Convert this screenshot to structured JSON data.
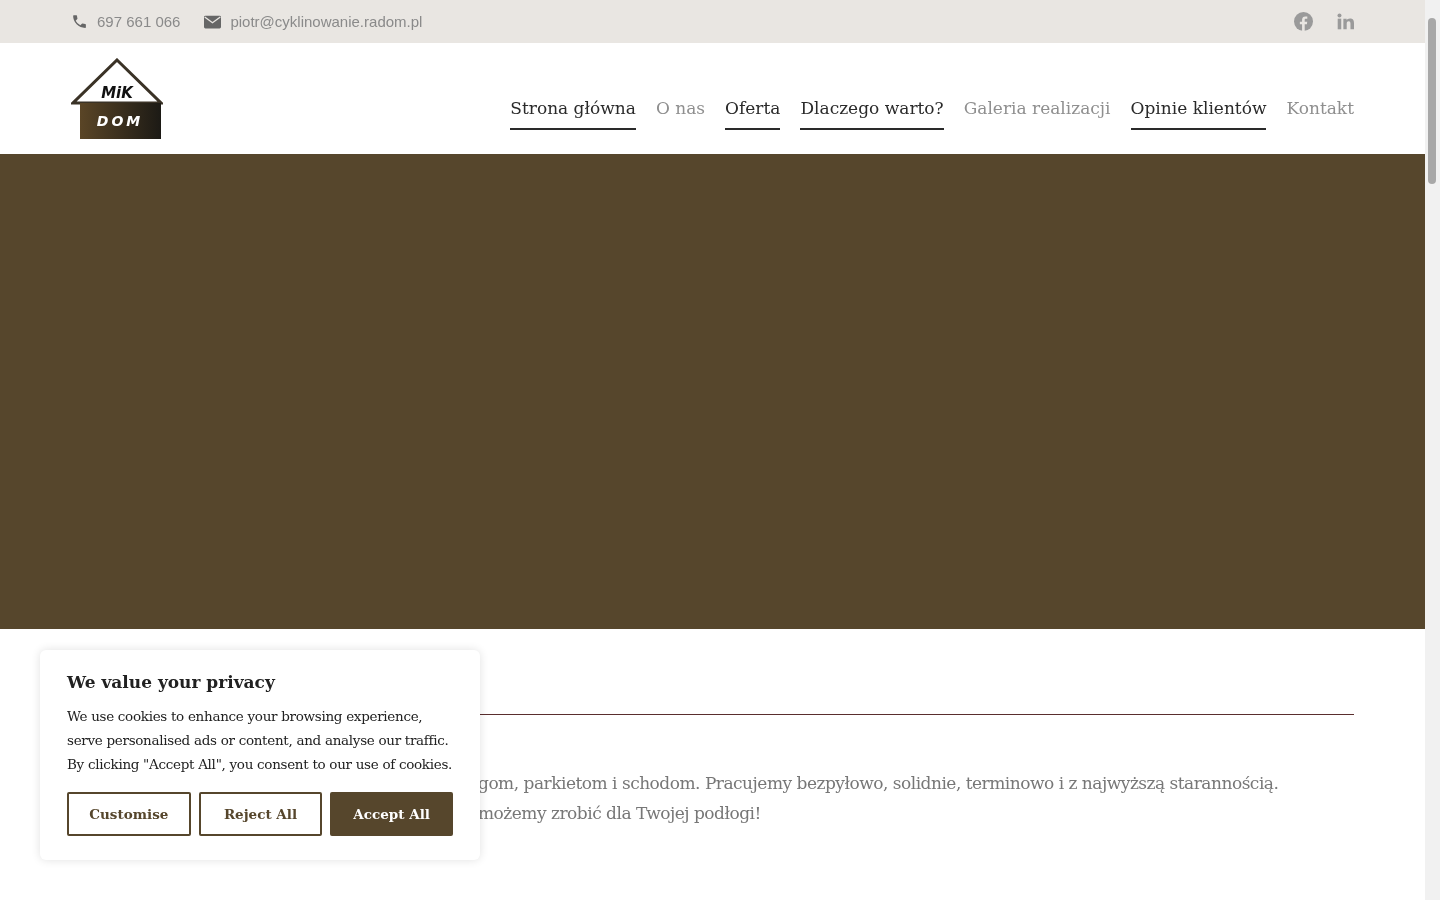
{
  "topbar": {
    "phone": "697 661 066",
    "email": "piotr@cyklinowanie.radom.pl"
  },
  "logo": {
    "top": "MiK",
    "bottom": "DOM"
  },
  "nav": [
    {
      "label": "Strona główna",
      "underlined": true
    },
    {
      "label": "O nas",
      "underlined": false
    },
    {
      "label": "Oferta",
      "underlined": true
    },
    {
      "label": "Dlaczego warto?",
      "underlined": true
    },
    {
      "label": "Galeria realizacji",
      "underlined": false
    },
    {
      "label": "Opinie klientów",
      "underlined": true
    },
    {
      "label": "Kontakt",
      "underlined": false
    }
  ],
  "intro": {
    "lines": [
      "gom, parkietom i schodom. Pracujemy bezpyłowo, solidnie, terminowo i z najwyższą starannością.",
      "możemy zrobić dla Twojej podłogi!"
    ]
  },
  "cookie_banner": {
    "title": "We value your privacy",
    "text": "We use cookies to enhance your browsing experience, serve personalised ads or content, and analyse our traffic. By clicking \"Accept All\", you consent to our use of cookies.",
    "buttons": [
      {
        "label": "Customise",
        "kind": "outline"
      },
      {
        "label": "Reject All",
        "kind": "outline"
      },
      {
        "label": "Accept All",
        "kind": "filled"
      }
    ]
  }
}
